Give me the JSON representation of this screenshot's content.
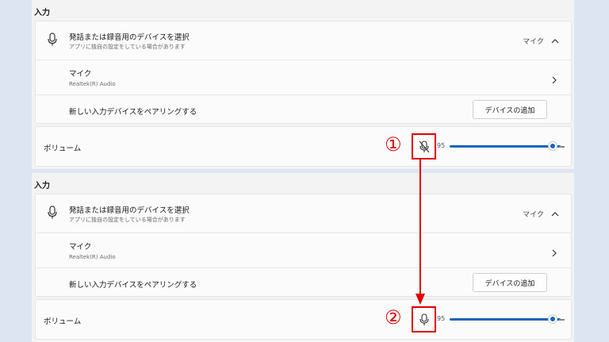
{
  "panels": [
    {
      "section_title": "入力",
      "device_select_title": "発話または録音用のデバイスを選択",
      "device_select_sub": "アプリに独自の設定をしている場合があります",
      "selected_device": "マイク",
      "mic_name": "マイク",
      "mic_driver": "Realtek(R) Audio",
      "pair_label": "新しい入力デバイスをペアリングする",
      "add_device_button": "デバイスの追加",
      "volume_label": "ボリューム",
      "volume_value": "95",
      "mic_muted": true,
      "annotation": "①"
    },
    {
      "section_title": "入力",
      "device_select_title": "発話または録音用のデバイスを選択",
      "device_select_sub": "アプリに独自の設定をしている場合があります",
      "selected_device": "マイク",
      "mic_name": "マイク",
      "mic_driver": "Realtek(R) Audio",
      "pair_label": "新しい入力デバイスをペアリングする",
      "add_device_button": "デバイスの追加",
      "volume_label": "ボリューム",
      "volume_value": "95",
      "mic_muted": false,
      "annotation": "②"
    }
  ],
  "colors": {
    "accent": "#1664c0",
    "annotation": "#e00000",
    "background": "#dde5f2"
  }
}
